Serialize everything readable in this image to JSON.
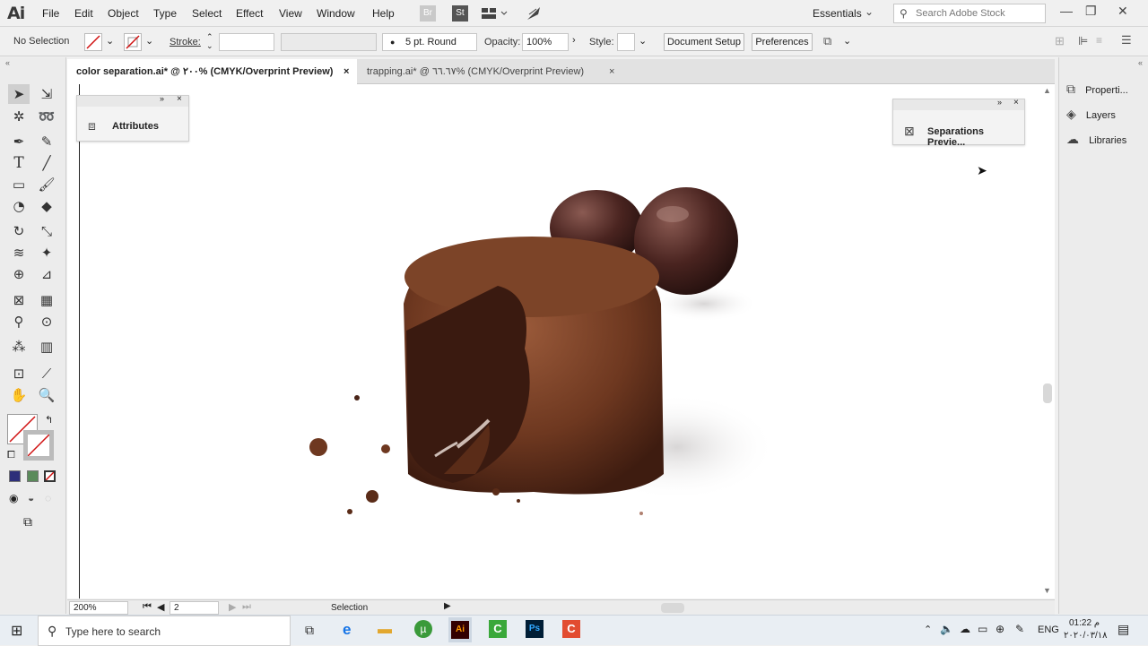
{
  "app": {
    "logo": "Ai",
    "menus": [
      "File",
      "Edit",
      "Object",
      "Type",
      "Select",
      "Effect",
      "View",
      "Window",
      "Help"
    ],
    "bridge_icon": "Br",
    "stock_icon": "St",
    "workspace": "Essentials",
    "search_placeholder": "Search Adobe Stock"
  },
  "control_bar": {
    "selection_status": "No Selection",
    "stroke_label": "Stroke:",
    "brush_label": "5 pt. Round",
    "opacity_label": "Opacity:",
    "opacity_value": "100%",
    "style_label": "Style:",
    "document_setup": "Document Setup",
    "preferences": "Preferences"
  },
  "tabs": [
    {
      "label": "color separation.ai* @ ٢٠٠% (CMYK/Overprint Preview)",
      "active": true
    },
    {
      "label": "trapping.ai* @ ٦٦.٦٧% (CMYK/Overprint Preview)",
      "active": false
    }
  ],
  "panels": {
    "attributes": "Attributes",
    "separations": "Separations Previe..."
  },
  "right_panel": {
    "items": [
      "Properti...",
      "Layers",
      "Libraries"
    ]
  },
  "status_bar": {
    "zoom": "200%",
    "artboard": "2",
    "tool": "Selection"
  },
  "taskbar": {
    "search_placeholder": "Type here to search",
    "language": "ENG",
    "time": "01:22 م",
    "date": "٢٠٢٠/٠٣/١٨"
  },
  "colors": {
    "accent": "#1473e6",
    "fill_swatch": "#2d2f7a",
    "green_swatch": "#5a8a5a",
    "none_swatch": "#d01010"
  }
}
